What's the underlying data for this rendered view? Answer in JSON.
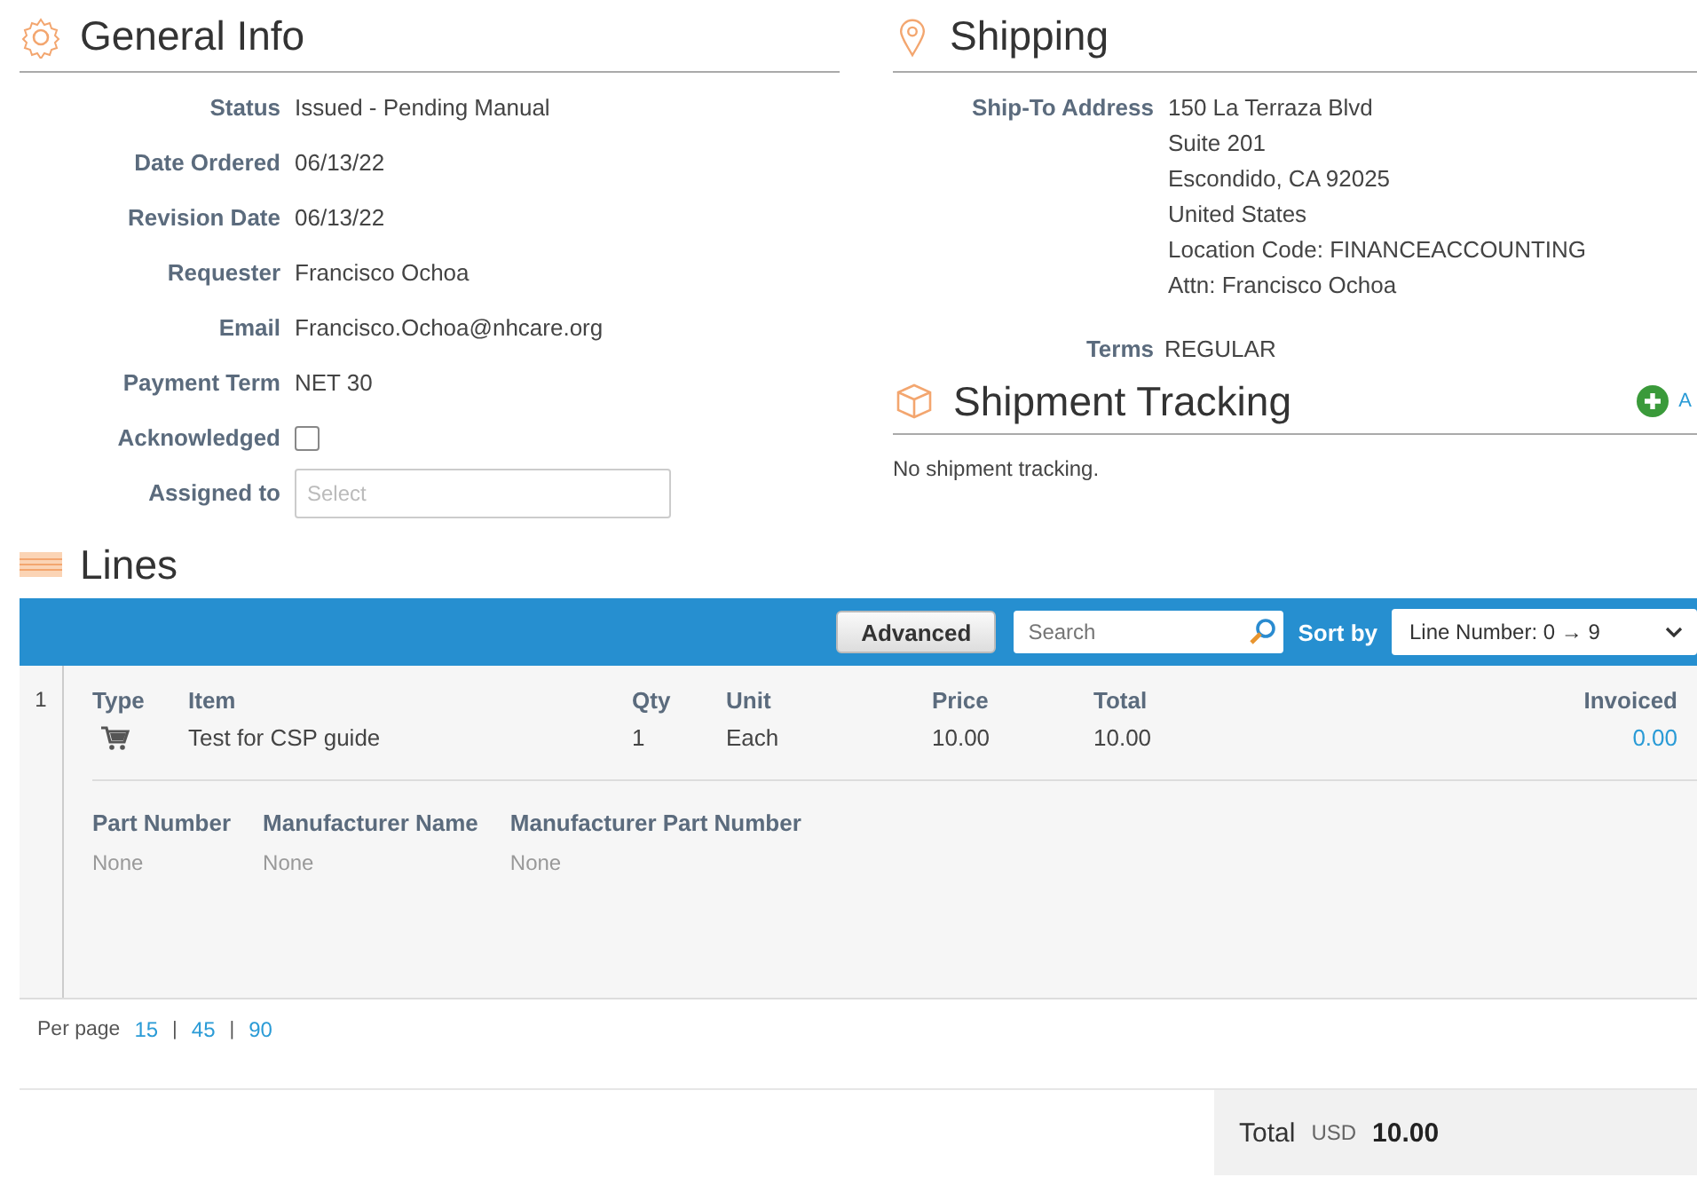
{
  "general_info": {
    "title": "General Info",
    "fields": [
      {
        "label": "Status",
        "value": "Issued - Pending Manual",
        "kind": "text"
      },
      {
        "label": "Date Ordered",
        "value": "06/13/22",
        "kind": "text"
      },
      {
        "label": "Revision Date",
        "value": "06/13/22",
        "kind": "text"
      },
      {
        "label": "Requester",
        "value": "Francisco Ochoa",
        "kind": "text"
      },
      {
        "label": "Email",
        "value": "Francisco.Ochoa@nhcare.org",
        "kind": "text"
      },
      {
        "label": "Payment Term",
        "value": "NET 30",
        "kind": "text"
      },
      {
        "label": "Acknowledged",
        "kind": "checkbox",
        "checked": false
      },
      {
        "label": "Assigned to",
        "kind": "select",
        "placeholder": "Select"
      }
    ]
  },
  "shipping": {
    "title": "Shipping",
    "address_label": "Ship-To Address",
    "address_lines": [
      "150 La Terraza Blvd",
      "Suite 201",
      "Escondido, CA 92025",
      "United States",
      "Location Code: FINANCEACCOUNTING",
      "Attn: Francisco Ochoa"
    ],
    "terms_label": "Terms",
    "terms": "REGULAR"
  },
  "shipment_tracking": {
    "title": "Shipment Tracking",
    "add_link": "A",
    "empty_text": "No shipment tracking."
  },
  "lines": {
    "title": "Lines",
    "advanced_button": "Advanced",
    "search": {
      "placeholder": "Search"
    },
    "sort_label": "Sort by",
    "sort_value": "Line Number: 0 → 9",
    "columns": [
      "Type",
      "Item",
      "Qty",
      "Unit",
      "Price",
      "Total",
      "Invoiced"
    ],
    "rows": [
      {
        "number": "1",
        "item": "Test for CSP guide",
        "qty": "1",
        "unit": "Each",
        "price": "10.00",
        "total": "10.00",
        "invoiced": "0.00",
        "details": [
          {
            "label": "Part Number",
            "value": "None"
          },
          {
            "label": "Manufacturer Name",
            "value": "None"
          },
          {
            "label": "Manufacturer Part Number",
            "value": "None"
          }
        ]
      }
    ],
    "per_page_label": "Per page",
    "per_page_options": [
      "15",
      "45",
      "90"
    ],
    "per_page_separator": "|"
  },
  "total": {
    "label": "Total",
    "currency": "USD",
    "amount": "10.00"
  }
}
